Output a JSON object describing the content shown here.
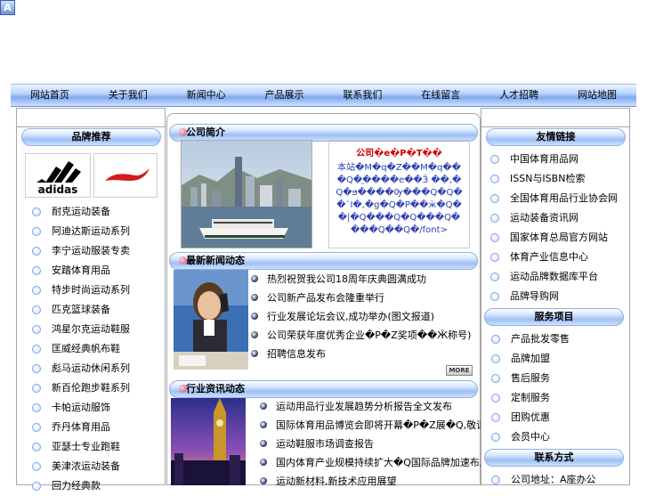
{
  "nav": [
    "网站首页",
    "关于我们",
    "新闻中心",
    "产品展示",
    "联系我们",
    "在线留言",
    "人才招聘",
    "网站地图"
  ],
  "left": {
    "header": "品牌推荐",
    "logos": [
      "adidas",
      "LI-NING"
    ],
    "items": [
      "耐克运动装备",
      "阿迪达斯运动系列",
      "李宁运动服装专卖",
      "安踏体育用品",
      "特步时尚运动系列",
      "匹克篮球装备",
      "鸿星尔克运动鞋服",
      "匡威经典帆布鞋",
      "彪马运动休闲系列",
      "新百伦跑步鞋系列",
      "卡帕运动服饰",
      "乔丹体育用品",
      "亚瑟士专业跑鞋",
      "美津浓运动装备",
      "回力经典款"
    ]
  },
  "center": {
    "section1": {
      "header": "公司简介",
      "text": "本站�M�q�Z��M�q���Q�֦����e��Ӟ ��,�Q�ϧ����Ѹ���Q�Q��`I�,�g�Q�P��ӝ�Q��|�Q���Q�Q���Q����Q��Q�/font>",
      "title_red": "公司�e�P�T��"
    },
    "section2": {
      "header": "最新新闻动态",
      "items": [
        "热烈祝贺我公司18周年庆典圆满成功",
        "公司新产品发布会隆重举行",
        "行业发展论坛会议,成功举办(图文报道)",
        "公司荣获年度优秀企业�P�Z奖项��Ӝ称号)",
        "招聘信息发布"
      ],
      "more": "MORE"
    },
    "section3": {
      "header": "行业资讯动态",
      "items": [
        "运动用品行业发展趋势分析报告全文发布",
        "国际体育用品博览会即将开幕�P�Z展�Q,敬请关注参与",
        "运动鞋服市场调查报告",
        "国内体育产业规模持续扩大�Q国际品牌加速布局中国二三线市场",
        "运动新材料,新技术应用展望"
      ]
    }
  },
  "right": {
    "header1": "友情链接",
    "links": [
      "中国体育用品网",
      "ISSN与ISBN检索",
      "全国体育用品行业协会网",
      "运动装备资讯网",
      "国家体育总局官方网站",
      "体育产业信息中心",
      "运动品牌数据库平台",
      "品牌导购网"
    ],
    "header2": "服务项目",
    "services": [
      "产品批发零售",
      "品牌加盟",
      "售后服务",
      "定制服务",
      "团购优惠",
      "会员中心"
    ],
    "header3": "联系方式",
    "contact": [
      "公司地址：A座办公"
    ]
  }
}
